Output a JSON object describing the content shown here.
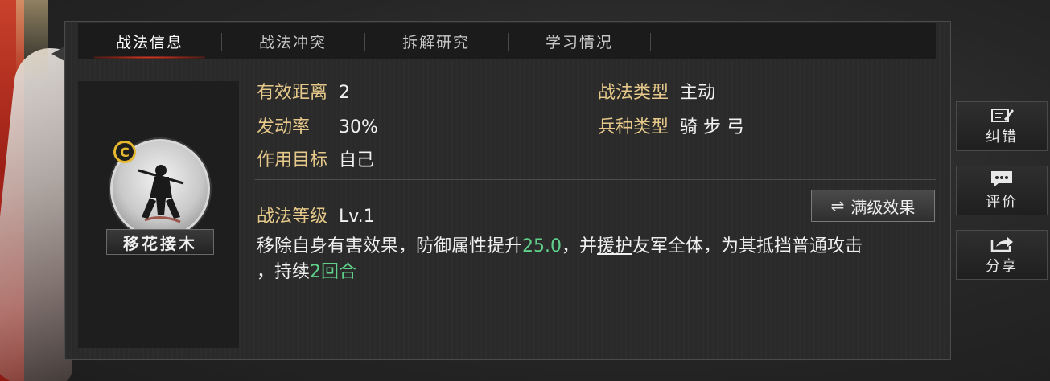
{
  "tabs": [
    {
      "label": "战法信息",
      "active": true
    },
    {
      "label": "战法冲突",
      "active": false
    },
    {
      "label": "拆解研究",
      "active": false
    },
    {
      "label": "学习情况",
      "active": false
    }
  ],
  "skill": {
    "grade": "C",
    "name": "移花接木"
  },
  "attributes": {
    "range_label": "有效距离",
    "range_value": "2",
    "rate_label": "发动率",
    "rate_value": "30%",
    "target_label": "作用目标",
    "target_value": "自己",
    "type_label": "战法类型",
    "type_value": "主动",
    "troop_label": "兵种类型",
    "troop_value": "骑 步 弓"
  },
  "level": {
    "label": "战法等级",
    "value": "Lv.1"
  },
  "max_effect_button": "满级效果",
  "description": {
    "part1": "移除自身有害效果，防御属性提升",
    "value1": "25.0",
    "part2": "，并",
    "keyword": "援护",
    "part3": "友军全体，为其抵挡普通攻击",
    "part4": "，持续",
    "value2": "2回合"
  },
  "side_buttons": {
    "report": "纠错",
    "review": "评价",
    "share": "分享"
  },
  "colors": {
    "label_gold": "#e6c98a",
    "highlight_green": "#5fd18a",
    "tab_active_red": "#e0402a",
    "grade_gold": "#e6b830"
  }
}
